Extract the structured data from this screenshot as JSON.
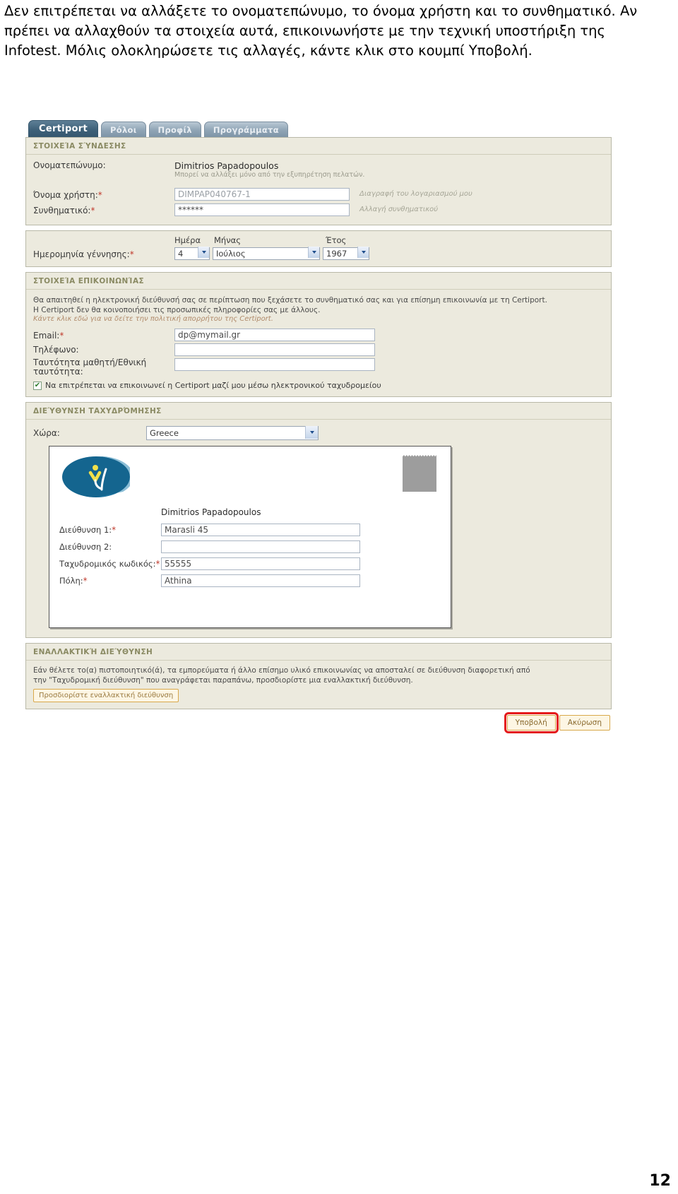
{
  "intro": {
    "text": "Δεν επιτρέπεται να αλλάξετε το ονοματεπώνυμο, το όνομα χρήστη και το συνθηματικό. Αν πρέπει να αλλαχθούν τα στοιχεία αυτά, επικοινωνήστε με την τεχνική υποστήριξη της Infotest. Μόλις ολοκληρώσετε τις αλλαγές, κάντε κλικ στο κουμπί Υποβολή."
  },
  "page_number": "12",
  "colors": {
    "panel_bg": "#eceade",
    "panel_border": "#b9b9a8",
    "section_heading": "#8a8a63",
    "required_star": "#c0392b",
    "tab_active": "#3e6179",
    "button_border": "#d8a84a",
    "highlight_outline": "#e4191b",
    "logo_blue": "#1b6d96"
  },
  "tabs": [
    {
      "label": "Certiport",
      "active": true
    },
    {
      "label": "Ρόλοι",
      "active": false
    },
    {
      "label": "Προφίλ",
      "active": false
    },
    {
      "label": "Προγράμματα",
      "active": false
    }
  ],
  "login_section": {
    "heading": "ΣΤΟΙΧΕΊΑ ΣΎΝΔΕΣΗΣ",
    "fullname_label": "Ονοματεπώνυμο:",
    "fullname_value": "Dimitrios Papadopoulos",
    "fullname_note": "Μπορεί να αλλάξει μόνο από την εξυπηρέτηση πελατών.",
    "username_label": "Όνομα χρήστη:",
    "username_required": "*",
    "username_value": "DIMPAP040767-1",
    "username_link": "Διαγραφή του λογαριασμού μου",
    "password_label": "Συνθηματικό:",
    "password_required": "*",
    "password_value": "******",
    "password_link": "Αλλαγή συνθηματικού"
  },
  "birth_section": {
    "label": "Ημερομηνία γέννησης:",
    "required": "*",
    "day_header": "Ημέρα",
    "month_header": "Μήνας",
    "year_header": "Έτος",
    "day_value": "4",
    "month_value": "Ιούλιος",
    "year_value": "1967"
  },
  "contact_section": {
    "heading": "ΣΤΟΙΧΕΊΑ ΕΠΙΚΟΙΝΩΝΊΑΣ",
    "paragraph_line1": "Θα απαιτηθεί η ηλεκτρονική διεύθυνσή σας σε περίπτωση που ξεχάσετε το συνθηματικό σας και για επίσημη επικοινωνία με τη Certiport.",
    "paragraph_line2": "Η Certiport δεν θα κοινοποιήσει τις προσωπικές πληροφορίες σας με άλλους.",
    "privacy_link": "Κάντε κλικ εδώ για να δείτε την πολιτική απορρήτου της Certiport.",
    "email_label": "Email:",
    "email_required": "*",
    "email_value": "dp@mymail.gr",
    "phone_label": "Τηλέφωνο:",
    "phone_value": "",
    "id_label": "Ταυτότητα μαθητή/Εθνική ταυτότητα:",
    "id_value": "",
    "checkbox_checked": true,
    "checkbox_label": "Να επιτρέπεται να επικοινωνεί η Certiport μαζί μου μέσω ηλεκτρονικού ταχυδρομείου"
  },
  "mailing_section": {
    "heading": "ΔΙΕΎΘΥΝΣΗ ΤΑΧΥΔΡΌΜΗΣΗΣ",
    "country_label": "Χώρα:",
    "country_value": "Greece",
    "envelope_name": "Dimitrios Papadopoulos",
    "address1_label": "Διεύθυνση 1:",
    "address1_required": "*",
    "address1_value": "Marasli 45",
    "address2_label": "Διεύθυνση 2:",
    "address2_value": "",
    "zip_label": "Ταχυδρομικός κωδικός:",
    "zip_required": "*",
    "zip_value": "55555",
    "city_label": "Πόλη:",
    "city_required": "*",
    "city_value": "Athina"
  },
  "alt_section": {
    "heading": "ΕΝΑΛΛΑΚΤΙΚΉ ΔΙΕΎΘΥΝΣΗ",
    "paragraph_line1": "Εάν θέλετε το(α) πιστοποιητικό(ά), τα εμπορεύματα ή άλλο επίσημο υλικό επικοινωνίας να αποσταλεί σε διεύθυνση διαφορετική από",
    "paragraph_line2": "την \"Ταχυδρομική διεύθυνση\" που αναγράφεται παραπάνω, προσδιορίστε μια εναλλακτική διεύθυνση.",
    "button_label": "Προσδιορίστε εναλλακτική διεύθυνση"
  },
  "actions": {
    "submit_label": "Υποβολή",
    "cancel_label": "Ακύρωση"
  }
}
